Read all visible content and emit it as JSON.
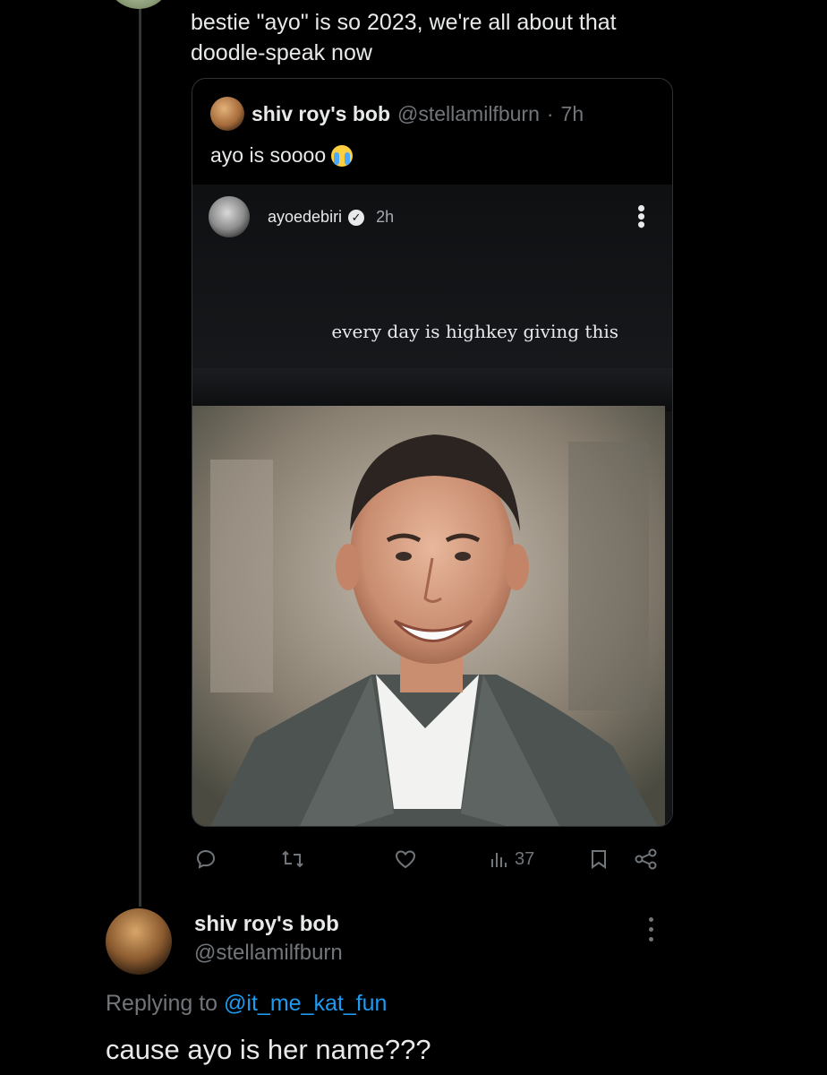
{
  "reply": {
    "line1": "bestie \"ayo\" is so 2023, we're all about that",
    "line2": "doodle-speak now"
  },
  "quote": {
    "name": "shiv roy's bob",
    "handle": "@stellamilfburn",
    "separator": "·",
    "time": "7h",
    "text": "ayo is soooo",
    "emoji": "loudly-crying-face"
  },
  "media": {
    "username": "ayoedebiri",
    "time": "2h",
    "caption": "every day is highkey giving this"
  },
  "actions": {
    "views": "37"
  },
  "post": {
    "name": "shiv roy's bob",
    "handle": "@stellamilfburn",
    "replying_label": "Replying to",
    "replying_to": "@it_me_kat_fun",
    "text": "cause ayo is her name???"
  },
  "colors": {
    "background": "#000000",
    "text": "#e7e9ea",
    "muted": "#71767b",
    "link": "#1d9bf0",
    "border": "#2f3336"
  }
}
